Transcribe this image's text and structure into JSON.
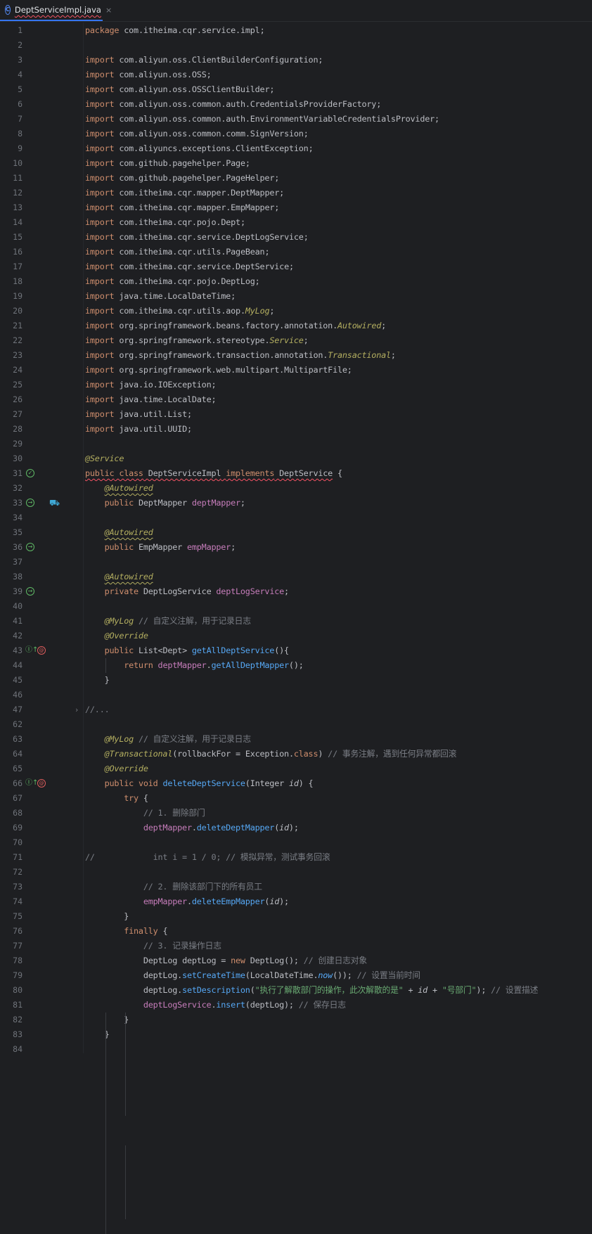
{
  "tab": {
    "title": "DeptServiceImpl.java",
    "icon": "class-icon",
    "close": "×"
  },
  "lines": [
    {
      "n": "1",
      "t": "package com.itheima.cqr.service.impl;"
    },
    {
      "n": "2",
      "t": ""
    },
    {
      "n": "3",
      "t": "import com.aliyun.oss.ClientBuilderConfiguration;"
    },
    {
      "n": "4",
      "t": "import com.aliyun.oss.OSS;"
    },
    {
      "n": "5",
      "t": "import com.aliyun.oss.OSSClientBuilder;"
    },
    {
      "n": "6",
      "t": "import com.aliyun.oss.common.auth.CredentialsProviderFactory;"
    },
    {
      "n": "7",
      "t": "import com.aliyun.oss.common.auth.EnvironmentVariableCredentialsProvider;"
    },
    {
      "n": "8",
      "t": "import com.aliyun.oss.common.comm.SignVersion;"
    },
    {
      "n": "9",
      "t": "import com.aliyuncs.exceptions.ClientException;"
    },
    {
      "n": "10",
      "t": "import com.github.pagehelper.Page;"
    },
    {
      "n": "11",
      "t": "import com.github.pagehelper.PageHelper;"
    },
    {
      "n": "12",
      "t": "import com.itheima.cqr.mapper.DeptMapper;"
    },
    {
      "n": "13",
      "t": "import com.itheima.cqr.mapper.EmpMapper;"
    },
    {
      "n": "14",
      "t": "import com.itheima.cqr.pojo.Dept;"
    },
    {
      "n": "15",
      "t": "import com.itheima.cqr.service.DeptLogService;"
    },
    {
      "n": "16",
      "t": "import com.itheima.cqr.utils.PageBean;"
    },
    {
      "n": "17",
      "t": "import com.itheima.cqr.service.DeptService;"
    },
    {
      "n": "18",
      "t": "import com.itheima.cqr.pojo.DeptLog;"
    },
    {
      "n": "19",
      "t": "import java.time.LocalDateTime;"
    },
    {
      "n": "20",
      "t": "import com.itheima.cqr.utils.aop.MyLog;"
    },
    {
      "n": "21",
      "t": "import org.springframework.beans.factory.annotation.Autowired;"
    },
    {
      "n": "22",
      "t": "import org.springframework.stereotype.Service;"
    },
    {
      "n": "23",
      "t": "import org.springframework.transaction.annotation.Transactional;"
    },
    {
      "n": "24",
      "t": "import org.springframework.web.multipart.MultipartFile;"
    },
    {
      "n": "25",
      "t": "import java.io.IOException;"
    },
    {
      "n": "26",
      "t": "import java.time.LocalDate;"
    },
    {
      "n": "27",
      "t": "import java.util.List;"
    },
    {
      "n": "28",
      "t": "import java.util.UUID;"
    },
    {
      "n": "29",
      "t": ""
    },
    {
      "n": "30",
      "t": "@Service"
    },
    {
      "n": "31",
      "t": "public class DeptServiceImpl implements DeptService {"
    },
    {
      "n": "32",
      "t": "    @Autowired"
    },
    {
      "n": "33",
      "t": "    public DeptMapper deptMapper;"
    },
    {
      "n": "34",
      "t": ""
    },
    {
      "n": "35",
      "t": "    @Autowired"
    },
    {
      "n": "36",
      "t": "    public EmpMapper empMapper;"
    },
    {
      "n": "37",
      "t": ""
    },
    {
      "n": "38",
      "t": "    @Autowired"
    },
    {
      "n": "39",
      "t": "    private DeptLogService deptLogService;"
    },
    {
      "n": "40",
      "t": ""
    },
    {
      "n": "41",
      "t": "    @MyLog // 自定义注解，用于记录日志"
    },
    {
      "n": "42",
      "t": "    @Override"
    },
    {
      "n": "43",
      "t": "    public List<Dept> getAllDeptService(){"
    },
    {
      "n": "44",
      "t": "        return deptMapper.getAllDeptMapper();"
    },
    {
      "n": "45",
      "t": "    }"
    },
    {
      "n": "46",
      "t": ""
    },
    {
      "n": "47",
      "t": "//..."
    },
    {
      "n": "62",
      "t": ""
    },
    {
      "n": "63",
      "t": "    @MyLog // 自定义注解，用于记录日志"
    },
    {
      "n": "64",
      "t": "    @Transactional(rollbackFor = Exception.class) // 事务注解，遇到任何异常都回滚"
    },
    {
      "n": "65",
      "t": "    @Override"
    },
    {
      "n": "66",
      "t": "    public void deleteDeptService(Integer id) {"
    },
    {
      "n": "67",
      "t": "        try {"
    },
    {
      "n": "68",
      "t": "            // 1. 删除部门"
    },
    {
      "n": "69",
      "t": "            deptMapper.deleteDeptMapper(id);"
    },
    {
      "n": "70",
      "t": ""
    },
    {
      "n": "71",
      "t": "//            int i = 1 / 0; // 模拟异常，测试事务回滚"
    },
    {
      "n": "72",
      "t": ""
    },
    {
      "n": "73",
      "t": "            // 2. 删除该部门下的所有员工"
    },
    {
      "n": "74",
      "t": "            empMapper.deleteEmpMapper(id);"
    },
    {
      "n": "75",
      "t": "        }"
    },
    {
      "n": "76",
      "t": "        finally {"
    },
    {
      "n": "77",
      "t": "            // 3. 记录操作日志"
    },
    {
      "n": "78",
      "t": "            DeptLog deptLog = new DeptLog(); // 创建日志对象"
    },
    {
      "n": "79",
      "t": "            deptLog.setCreateTime(LocalDateTime.now()); // 设置当前时间"
    },
    {
      "n": "80",
      "t": "            deptLog.setDescription(\"执行了解散部门的操作，此次解散的是\" + id + \"号部门\"); // 设置描述"
    },
    {
      "n": "81",
      "t": "            deptLogService.insert(deptLog); // 保存日志"
    },
    {
      "n": "82",
      "t": "        }"
    },
    {
      "n": "83",
      "t": "    }"
    },
    {
      "n": "84",
      "t": ""
    }
  ],
  "gutter_icons": {
    "31": "bean-class-icon",
    "33": "bean-injection-icon",
    "36": "bean-injection-icon",
    "39": "bean-injection-icon",
    "43": "implements-method-icon",
    "66": "implements-method-icon"
  },
  "colors": {
    "background": "#1e1f22",
    "keyword": "#cf8e6d",
    "annotation": "#b3ae60",
    "string": "#6aab73",
    "comment": "#7a7e85",
    "field": "#c77dbb",
    "method": "#56a8f5",
    "number": "#2aacb8"
  }
}
